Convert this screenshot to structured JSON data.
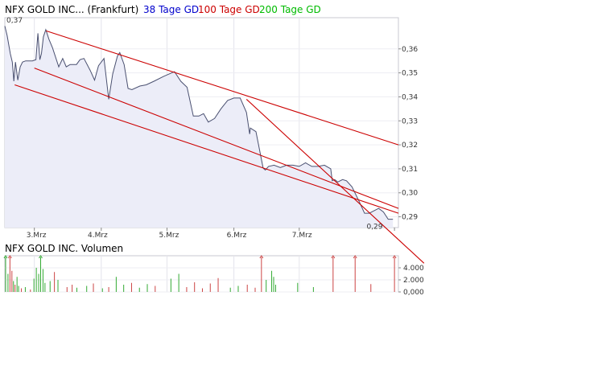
{
  "chart_data": [
    {
      "type": "line",
      "title": "NFX GOLD INC... (Frankfurt)",
      "legend": [
        {
          "label": "38 Tage GD",
          "color": "#0000cc"
        },
        {
          "label": "100 Tage GD",
          "color": "#cc0000"
        },
        {
          "label": "200 Tage GD",
          "color": "#00bb00"
        }
      ],
      "legend_placement": "top",
      "x_tick_labels": [
        "3.Mrz",
        "4.Mrz",
        "5.Mrz",
        "6.Mrz",
        "7.Mrz"
      ],
      "y_tick_labels": [
        "0,36",
        "0,35",
        "0,34",
        "0,33",
        "0,32",
        "0,31",
        "0,30",
        "0,29"
      ],
      "ylim": [
        0.2855,
        0.373
      ],
      "xlim": [
        0,
        100
      ],
      "grid": true,
      "price_color": "#4a5070",
      "area_fill": "#ecedf8",
      "trendline_color": "#cc0000",
      "annotations": [
        {
          "text": "0,37",
          "x": 0,
          "y": 0.37
        },
        {
          "text": "0,29",
          "x": 96,
          "y": 0.289
        }
      ],
      "series": [
        {
          "x": [
            0,
            0.6,
            1.4,
            1.9,
            2.3,
            2.7,
            3.3,
            3.9,
            4.5,
            5.3,
            6.2,
            7.0,
            7.9,
            8.4,
            8.9,
            9.3,
            9.8,
            10.4,
            11.2,
            12.1,
            13.7,
            14.7,
            15.6,
            16.6,
            18.2,
            19.1,
            20.1,
            21.7,
            22.8,
            23.8,
            25.2,
            26.4,
            27.4,
            28.6,
            29.2,
            30.3,
            31.3,
            32.3,
            34.3,
            35.9,
            37.9,
            40.3,
            43.1,
            44.7,
            46.3,
            47.9,
            49.3,
            50.5,
            51.7,
            53.3,
            54.9,
            56.6,
            58.2,
            59.8,
            61.4,
            62.2,
            62.4,
            63.8,
            65.6,
            65.8,
            66.2,
            67.0,
            68.4,
            70.0,
            71.6,
            73.2,
            74.8,
            76.4,
            78.0,
            79.6,
            81.2,
            82.8,
            83.2,
            83.8,
            84.6,
            85.8,
            86.8,
            88.2,
            90.0,
            91.4,
            92.6,
            93.8,
            95.0,
            96.2,
            97.4,
            98.6
          ],
          "y": [
            0.3695,
            0.3655,
            0.358,
            0.3545,
            0.3465,
            0.3545,
            0.347,
            0.3525,
            0.3545,
            0.355,
            0.355,
            0.355,
            0.3555,
            0.3665,
            0.3555,
            0.358,
            0.365,
            0.368,
            0.364,
            0.3605,
            0.3525,
            0.356,
            0.3525,
            0.3535,
            0.3535,
            0.3555,
            0.356,
            0.351,
            0.347,
            0.353,
            0.356,
            0.339,
            0.3495,
            0.357,
            0.3585,
            0.3535,
            0.3435,
            0.343,
            0.3445,
            0.345,
            0.3465,
            0.3485,
            0.3505,
            0.3465,
            0.344,
            0.332,
            0.332,
            0.333,
            0.3295,
            0.331,
            0.335,
            0.3385,
            0.3395,
            0.3395,
            0.3335,
            0.3245,
            0.327,
            0.3255,
            0.3105,
            0.31,
            0.3095,
            0.311,
            0.3115,
            0.3105,
            0.3115,
            0.3115,
            0.311,
            0.3125,
            0.311,
            0.311,
            0.3115,
            0.31,
            0.305,
            0.3055,
            0.3045,
            0.3055,
            0.305,
            0.3025,
            0.2965,
            0.2915,
            0.2915,
            0.2925,
            0.2935,
            0.292,
            0.289,
            0.289
          ]
        }
      ],
      "trend_lines": [
        {
          "x1": 10.5,
          "y1": 0.3675,
          "x2": 100,
          "y2": 0.32
        },
        {
          "x1": 7.5,
          "y1": 0.352,
          "x2": 100,
          "y2": 0.2935
        },
        {
          "x1": 2.5,
          "y1": 0.345,
          "x2": 100,
          "y2": 0.2915
        },
        {
          "x1": 61.4,
          "y1": 0.339,
          "x2": 100,
          "y2": 0.2805
        }
      ]
    },
    {
      "type": "bar",
      "title": "NFX GOLD INC. Volumen",
      "y_tick_labels": [
        "4.000",
        "2.000",
        "0,000"
      ],
      "ylim": [
        0,
        6000
      ],
      "grid": true,
      "up_color": "#33aa33",
      "down_color": "#cc4444",
      "bars": [
        {
          "x": 0.2,
          "v": 6000,
          "c": "up",
          "cap": true
        },
        {
          "x": 0.8,
          "v": 3000,
          "c": "up"
        },
        {
          "x": 1.3,
          "v": 6000,
          "c": "down",
          "cap": true
        },
        {
          "x": 1.8,
          "v": 3500,
          "c": "down"
        },
        {
          "x": 2.2,
          "v": 1800,
          "c": "up"
        },
        {
          "x": 2.6,
          "v": 1200,
          "c": "down"
        },
        {
          "x": 3.1,
          "v": 2500,
          "c": "up"
        },
        {
          "x": 3.5,
          "v": 1000,
          "c": "up"
        },
        {
          "x": 4.2,
          "v": 600,
          "c": "down"
        },
        {
          "x": 5.2,
          "v": 800,
          "c": "up"
        },
        {
          "x": 6.5,
          "v": 400,
          "c": "down"
        },
        {
          "x": 7.4,
          "v": 2200,
          "c": "up"
        },
        {
          "x": 8.0,
          "v": 4000,
          "c": "up"
        },
        {
          "x": 8.6,
          "v": 3000,
          "c": "up"
        },
        {
          "x": 9.1,
          "v": 6000,
          "c": "up",
          "cap": true
        },
        {
          "x": 9.7,
          "v": 3800,
          "c": "up"
        },
        {
          "x": 10.2,
          "v": 1500,
          "c": "up"
        },
        {
          "x": 11.5,
          "v": 1800,
          "c": "up"
        },
        {
          "x": 12.6,
          "v": 3300,
          "c": "down"
        },
        {
          "x": 13.5,
          "v": 2000,
          "c": "up"
        },
        {
          "x": 15.8,
          "v": 800,
          "c": "down"
        },
        {
          "x": 17.1,
          "v": 1200,
          "c": "down"
        },
        {
          "x": 18.3,
          "v": 700,
          "c": "up"
        },
        {
          "x": 20.8,
          "v": 1000,
          "c": "up"
        },
        {
          "x": 22.5,
          "v": 1400,
          "c": "down"
        },
        {
          "x": 24.8,
          "v": 600,
          "c": "up"
        },
        {
          "x": 26.4,
          "v": 800,
          "c": "down"
        },
        {
          "x": 28.3,
          "v": 2500,
          "c": "up"
        },
        {
          "x": 30.2,
          "v": 1200,
          "c": "up"
        },
        {
          "x": 32.2,
          "v": 1500,
          "c": "down"
        },
        {
          "x": 34.2,
          "v": 700,
          "c": "up"
        },
        {
          "x": 36.2,
          "v": 1300,
          "c": "up"
        },
        {
          "x": 38.2,
          "v": 1000,
          "c": "down"
        },
        {
          "x": 42.2,
          "v": 2200,
          "c": "up"
        },
        {
          "x": 44.2,
          "v": 3000,
          "c": "up"
        },
        {
          "x": 46.2,
          "v": 800,
          "c": "down"
        },
        {
          "x": 48.2,
          "v": 1600,
          "c": "down"
        },
        {
          "x": 50.2,
          "v": 600,
          "c": "down"
        },
        {
          "x": 52.2,
          "v": 1400,
          "c": "down"
        },
        {
          "x": 54.2,
          "v": 2300,
          "c": "down"
        },
        {
          "x": 57.3,
          "v": 700,
          "c": "up"
        },
        {
          "x": 59.3,
          "v": 1000,
          "c": "up"
        },
        {
          "x": 61.6,
          "v": 1200,
          "c": "down"
        },
        {
          "x": 63.6,
          "v": 700,
          "c": "down"
        },
        {
          "x": 65.2,
          "v": 6000,
          "c": "down",
          "cap": true
        },
        {
          "x": 66.4,
          "v": 2000,
          "c": "up"
        },
        {
          "x": 67.8,
          "v": 3500,
          "c": "up"
        },
        {
          "x": 68.3,
          "v": 2500,
          "c": "up"
        },
        {
          "x": 68.8,
          "v": 1200,
          "c": "up"
        },
        {
          "x": 74.4,
          "v": 1500,
          "c": "up"
        },
        {
          "x": 78.4,
          "v": 800,
          "c": "up"
        },
        {
          "x": 83.4,
          "v": 6000,
          "c": "down",
          "cap": true
        },
        {
          "x": 89.0,
          "v": 6000,
          "c": "down",
          "cap": true
        },
        {
          "x": 93.0,
          "v": 1300,
          "c": "down"
        },
        {
          "x": 99.0,
          "v": 6000,
          "c": "down",
          "cap": true
        }
      ]
    }
  ]
}
